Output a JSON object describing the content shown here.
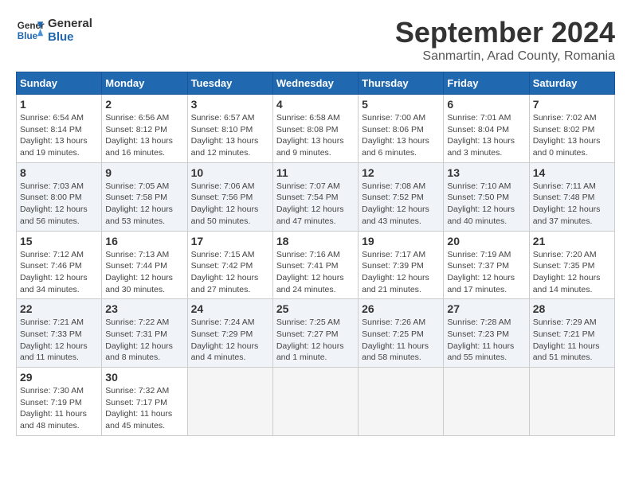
{
  "logo": {
    "line1": "General",
    "line2": "Blue"
  },
  "title": "September 2024",
  "subtitle": "Sanmartin, Arad County, Romania",
  "weekdays": [
    "Sunday",
    "Monday",
    "Tuesday",
    "Wednesday",
    "Thursday",
    "Friday",
    "Saturday"
  ],
  "weeks": [
    [
      {
        "day": "1",
        "info": "Sunrise: 6:54 AM\nSunset: 8:14 PM\nDaylight: 13 hours\nand 19 minutes."
      },
      {
        "day": "2",
        "info": "Sunrise: 6:56 AM\nSunset: 8:12 PM\nDaylight: 13 hours\nand 16 minutes."
      },
      {
        "day": "3",
        "info": "Sunrise: 6:57 AM\nSunset: 8:10 PM\nDaylight: 13 hours\nand 12 minutes."
      },
      {
        "day": "4",
        "info": "Sunrise: 6:58 AM\nSunset: 8:08 PM\nDaylight: 13 hours\nand 9 minutes."
      },
      {
        "day": "5",
        "info": "Sunrise: 7:00 AM\nSunset: 8:06 PM\nDaylight: 13 hours\nand 6 minutes."
      },
      {
        "day": "6",
        "info": "Sunrise: 7:01 AM\nSunset: 8:04 PM\nDaylight: 13 hours\nand 3 minutes."
      },
      {
        "day": "7",
        "info": "Sunrise: 7:02 AM\nSunset: 8:02 PM\nDaylight: 13 hours\nand 0 minutes."
      }
    ],
    [
      {
        "day": "8",
        "info": "Sunrise: 7:03 AM\nSunset: 8:00 PM\nDaylight: 12 hours\nand 56 minutes."
      },
      {
        "day": "9",
        "info": "Sunrise: 7:05 AM\nSunset: 7:58 PM\nDaylight: 12 hours\nand 53 minutes."
      },
      {
        "day": "10",
        "info": "Sunrise: 7:06 AM\nSunset: 7:56 PM\nDaylight: 12 hours\nand 50 minutes."
      },
      {
        "day": "11",
        "info": "Sunrise: 7:07 AM\nSunset: 7:54 PM\nDaylight: 12 hours\nand 47 minutes."
      },
      {
        "day": "12",
        "info": "Sunrise: 7:08 AM\nSunset: 7:52 PM\nDaylight: 12 hours\nand 43 minutes."
      },
      {
        "day": "13",
        "info": "Sunrise: 7:10 AM\nSunset: 7:50 PM\nDaylight: 12 hours\nand 40 minutes."
      },
      {
        "day": "14",
        "info": "Sunrise: 7:11 AM\nSunset: 7:48 PM\nDaylight: 12 hours\nand 37 minutes."
      }
    ],
    [
      {
        "day": "15",
        "info": "Sunrise: 7:12 AM\nSunset: 7:46 PM\nDaylight: 12 hours\nand 34 minutes."
      },
      {
        "day": "16",
        "info": "Sunrise: 7:13 AM\nSunset: 7:44 PM\nDaylight: 12 hours\nand 30 minutes."
      },
      {
        "day": "17",
        "info": "Sunrise: 7:15 AM\nSunset: 7:42 PM\nDaylight: 12 hours\nand 27 minutes."
      },
      {
        "day": "18",
        "info": "Sunrise: 7:16 AM\nSunset: 7:41 PM\nDaylight: 12 hours\nand 24 minutes."
      },
      {
        "day": "19",
        "info": "Sunrise: 7:17 AM\nSunset: 7:39 PM\nDaylight: 12 hours\nand 21 minutes."
      },
      {
        "day": "20",
        "info": "Sunrise: 7:19 AM\nSunset: 7:37 PM\nDaylight: 12 hours\nand 17 minutes."
      },
      {
        "day": "21",
        "info": "Sunrise: 7:20 AM\nSunset: 7:35 PM\nDaylight: 12 hours\nand 14 minutes."
      }
    ],
    [
      {
        "day": "22",
        "info": "Sunrise: 7:21 AM\nSunset: 7:33 PM\nDaylight: 12 hours\nand 11 minutes."
      },
      {
        "day": "23",
        "info": "Sunrise: 7:22 AM\nSunset: 7:31 PM\nDaylight: 12 hours\nand 8 minutes."
      },
      {
        "day": "24",
        "info": "Sunrise: 7:24 AM\nSunset: 7:29 PM\nDaylight: 12 hours\nand 4 minutes."
      },
      {
        "day": "25",
        "info": "Sunrise: 7:25 AM\nSunset: 7:27 PM\nDaylight: 12 hours\nand 1 minute."
      },
      {
        "day": "26",
        "info": "Sunrise: 7:26 AM\nSunset: 7:25 PM\nDaylight: 11 hours\nand 58 minutes."
      },
      {
        "day": "27",
        "info": "Sunrise: 7:28 AM\nSunset: 7:23 PM\nDaylight: 11 hours\nand 55 minutes."
      },
      {
        "day": "28",
        "info": "Sunrise: 7:29 AM\nSunset: 7:21 PM\nDaylight: 11 hours\nand 51 minutes."
      }
    ],
    [
      {
        "day": "29",
        "info": "Sunrise: 7:30 AM\nSunset: 7:19 PM\nDaylight: 11 hours\nand 48 minutes."
      },
      {
        "day": "30",
        "info": "Sunrise: 7:32 AM\nSunset: 7:17 PM\nDaylight: 11 hours\nand 45 minutes."
      },
      {
        "day": "",
        "info": ""
      },
      {
        "day": "",
        "info": ""
      },
      {
        "day": "",
        "info": ""
      },
      {
        "day": "",
        "info": ""
      },
      {
        "day": "",
        "info": ""
      }
    ]
  ]
}
